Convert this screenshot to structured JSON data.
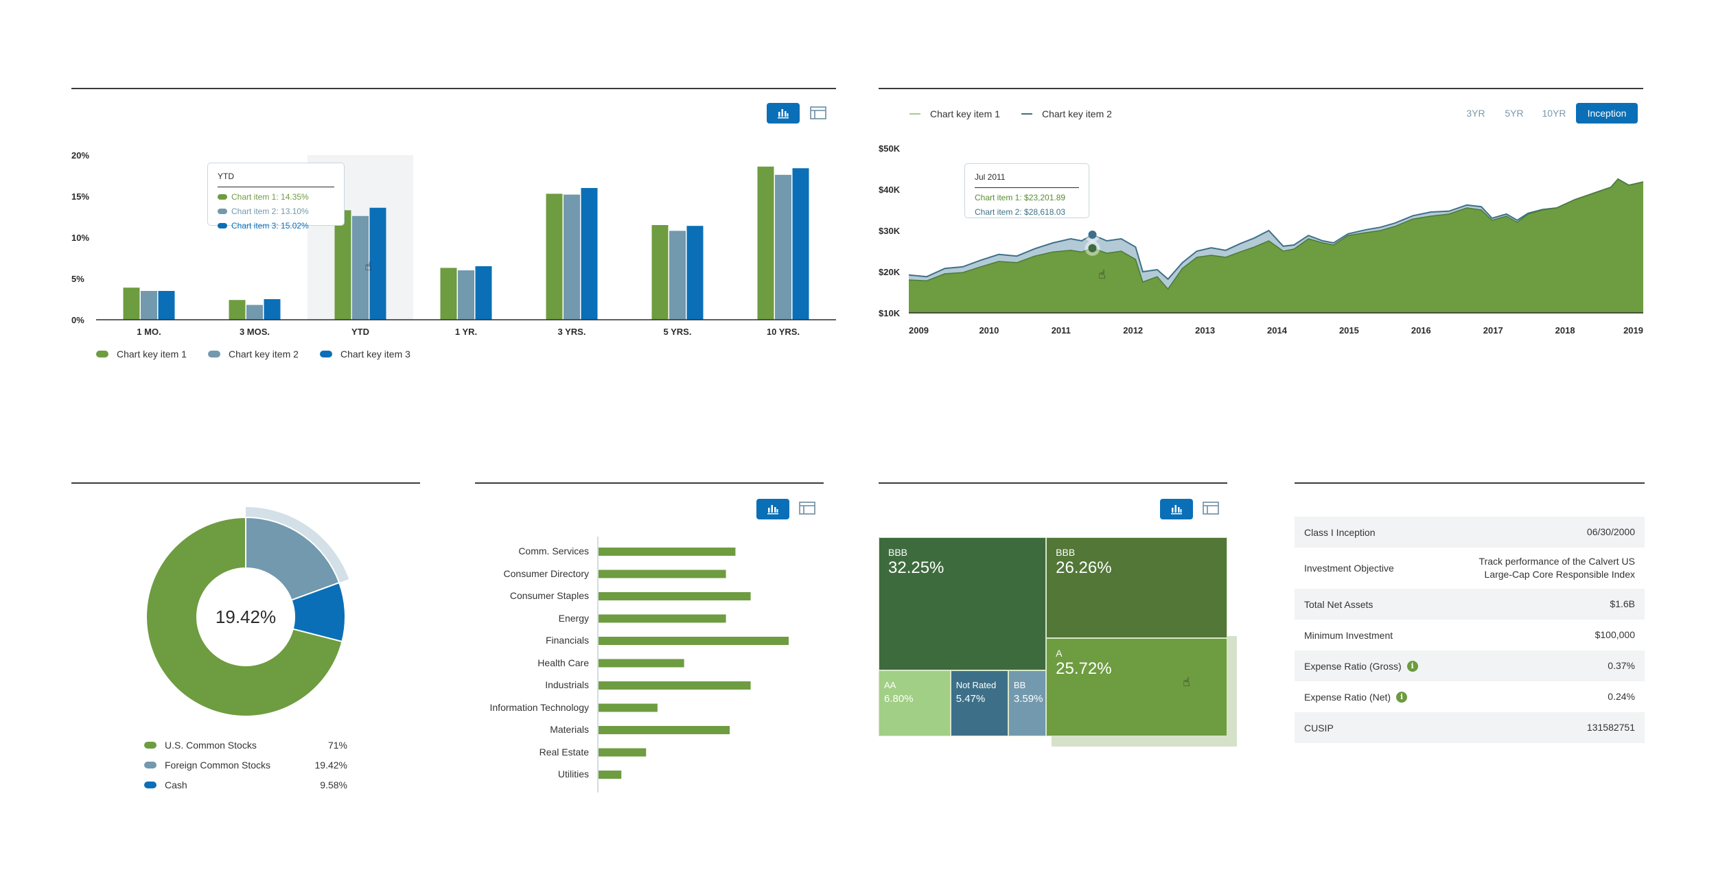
{
  "colors": {
    "green": "#6e9c40",
    "slate": "#7299ad",
    "blue": "#0a6fb7",
    "dark_slate": "#3d7088",
    "hover_bg": "#f1f3f4",
    "highlight_ring": "#d4e0e7"
  },
  "view_toggle": {
    "chart_icon": "bar-chart-icon",
    "table_icon": "table-icon"
  },
  "chart_data": [
    {
      "id": "performance-bars",
      "type": "bar",
      "title": "",
      "xlabel": "",
      "ylabel": "",
      "categories": [
        "1 MO.",
        "3 MOS.",
        "YTD",
        "1 YR.",
        "3 YRS.",
        "5 YRS.",
        "10 YRS."
      ],
      "series": [
        {
          "name": "Chart key item 1",
          "color": "#6e9c40",
          "values": [
            3.9,
            2.4,
            13.3,
            6.3,
            15.3,
            11.5,
            18.6
          ]
        },
        {
          "name": "Chart key item 2",
          "color": "#7299ad",
          "values": [
            3.5,
            1.8,
            12.6,
            6.0,
            15.2,
            10.8,
            17.6
          ]
        },
        {
          "name": "Chart key item 3",
          "color": "#0a6fb7",
          "values": [
            3.5,
            2.5,
            13.6,
            6.5,
            16.0,
            11.4,
            18.4
          ]
        }
      ],
      "yticks": [
        "0%",
        "5%",
        "10%",
        "15%",
        "20%"
      ],
      "ylim": [
        0,
        20
      ],
      "grid": false,
      "legend_position": "bottom-left",
      "highlighted_category": "YTD",
      "tooltip": {
        "title": "YTD",
        "rows": [
          {
            "label": "Chart item 1: 14.35%",
            "color": "#6e9c40"
          },
          {
            "label": "Chart item 2: 13.10%",
            "color": "#7299ad"
          },
          {
            "label": "Chart item 3: 15.02%",
            "color": "#0a6fb7"
          }
        ]
      }
    },
    {
      "id": "growth-area",
      "type": "area",
      "title": "",
      "xlabel": "",
      "ylabel": "",
      "ylim": [
        10000,
        50000
      ],
      "yticks": [
        "$10K",
        "$20K",
        "$30K",
        "$40K",
        "$50K"
      ],
      "xticks": [
        "2009",
        "2010",
        "2011",
        "2012",
        "2013",
        "2014",
        "2015",
        "2016",
        "2017",
        "2018",
        "2019"
      ],
      "xlim": [
        2009.0,
        2019.2
      ],
      "grid": false,
      "legend_position": "top-left",
      "x": [
        2009.0,
        2009.25,
        2009.5,
        2009.75,
        2010.0,
        2010.25,
        2010.5,
        2010.75,
        2011.0,
        2011.25,
        2011.4,
        2011.55,
        2011.75,
        2011.95,
        2012.15,
        2012.25,
        2012.45,
        2012.6,
        2012.8,
        2013.0,
        2013.2,
        2013.4,
        2013.6,
        2013.8,
        2014.0,
        2014.2,
        2014.35,
        2014.55,
        2014.75,
        2014.9,
        2015.1,
        2015.35,
        2015.55,
        2015.75,
        2016.0,
        2016.25,
        2016.5,
        2016.75,
        2016.95,
        2017.1,
        2017.3,
        2017.45,
        2017.6,
        2017.8,
        2018.0,
        2018.25,
        2018.5,
        2018.75,
        2018.85,
        2019.0,
        2019.2
      ],
      "series": [
        {
          "name": "Chart key item 1",
          "color": "#6e9c40",
          "values": [
            18000,
            17800,
            19500,
            19800,
            21200,
            22500,
            22200,
            23800,
            24800,
            25200,
            24800,
            25700,
            24500,
            25000,
            23000,
            17500,
            18800,
            15800,
            20800,
            23500,
            24000,
            23500,
            24800,
            26000,
            27500,
            25000,
            25500,
            28000,
            27000,
            26500,
            28800,
            29500,
            30000,
            31000,
            32800,
            33500,
            34000,
            35500,
            35000,
            32500,
            33500,
            32000,
            34000,
            35000,
            35500,
            37500,
            39000,
            40500,
            42500,
            41000,
            41800
          ]
        },
        {
          "name": "Chart key item 2",
          "color": "#3d7088",
          "values": [
            19200,
            18800,
            20800,
            21200,
            22800,
            24200,
            23800,
            25600,
            27000,
            28000,
            27500,
            29000,
            27500,
            28000,
            26000,
            20000,
            20500,
            18200,
            22200,
            25000,
            25800,
            25200,
            26800,
            28200,
            30000,
            26200,
            26500,
            28800,
            27500,
            27000,
            29200,
            30200,
            30800,
            31800,
            33600,
            34500,
            34700,
            36200,
            35800,
            33000,
            34000,
            32500,
            34200,
            35100,
            35500,
            37500,
            39000,
            40500,
            42500,
            41000,
            41800
          ]
        }
      ],
      "tooltip": {
        "title": "Jul 2011",
        "rows": [
          {
            "label": "Chart item 1: $23,201.89",
            "color": "#5a8a34"
          },
          {
            "label": "Chart item 2: $28,618.03",
            "color": "#3d7088"
          }
        ]
      },
      "hover_x": 2011.55,
      "range_tabs": [
        {
          "label": "3YR",
          "active": false
        },
        {
          "label": "5YR",
          "active": false
        },
        {
          "label": "10YR",
          "active": false
        },
        {
          "label": "Inception",
          "active": true
        }
      ]
    },
    {
      "id": "allocation-donut",
      "type": "pie",
      "title": "",
      "center_label": "19.42%",
      "highlighted_slice": "Foreign Common Stocks",
      "slices": [
        {
          "label": "Foreign Common Stocks",
          "value": 19.42,
          "display": "19.42%",
          "color": "#7299ad"
        },
        {
          "label": "Cash",
          "value": 9.58,
          "display": "9.58%",
          "color": "#0a6fb7"
        },
        {
          "label": "U.S. Common Stocks",
          "value": 71,
          "display": "71%",
          "color": "#6e9c40"
        }
      ],
      "legend_order": [
        "U.S. Common Stocks",
        "Foreign Common Stocks",
        "Cash"
      ],
      "legend_position": "bottom"
    },
    {
      "id": "sector-bars",
      "type": "bar",
      "orientation": "horizontal",
      "title": "",
      "xlabel": "",
      "ylabel": "",
      "categories": [
        "Comm. Services",
        "Consumer Directory",
        "Consumer Staples",
        "Energy",
        "Financials",
        "Health Care",
        "Industrials",
        "Information Technology",
        "Materials",
        "Real Estate",
        "Utilities"
      ],
      "values": [
        0.72,
        0.67,
        0.8,
        0.67,
        1.0,
        0.45,
        0.8,
        0.31,
        0.69,
        0.25,
        0.12
      ],
      "value_units": "relative to largest (no axis scale shown)",
      "color": "#6e9c40",
      "grid": false
    },
    {
      "id": "credit-treemap",
      "type": "heatmap",
      "subtype": "treemap",
      "title": "",
      "highlighted_cell": "A",
      "cells": [
        {
          "name": "BBB",
          "value": 32.25,
          "display": "32.25%",
          "color": "#3e6b3d"
        },
        {
          "name": "BBB",
          "value": 26.26,
          "display": "26.26%",
          "color": "#527737"
        },
        {
          "name": "A",
          "value": 25.72,
          "display": "25.72%",
          "color": "#6e9c40"
        },
        {
          "name": "AA",
          "value": 6.8,
          "display": "6.80%",
          "color": "#a1cf85"
        },
        {
          "name": "Not Rated",
          "value": 5.47,
          "display": "5.47%",
          "color": "#3d7088"
        },
        {
          "name": "BB",
          "value": 3.59,
          "display": "3.59%",
          "color": "#7299ad"
        }
      ]
    }
  ],
  "fund_facts": {
    "rows": [
      {
        "label": "Class I Inception",
        "value": "06/30/2000",
        "info": false
      },
      {
        "label": "Investment Objective",
        "value": "Track performance of the Calvert US Large-Cap Core Responsible Index",
        "value_lines": [
          "Track performance of the Calvert US",
          "Large-Cap Core Responsible Index"
        ],
        "info": false
      },
      {
        "label": "Total Net Assets",
        "value": "$1.6B",
        "info": false
      },
      {
        "label": "Minimum Investment",
        "value": "$100,000",
        "info": false
      },
      {
        "label": "Expense Ratio (Gross)",
        "value": "0.37%",
        "info": true
      },
      {
        "label": "Expense Ratio (Net)",
        "value": "0.24%",
        "info": true
      },
      {
        "label": "CUSIP",
        "value": "131582751",
        "info": false
      }
    ],
    "info_icon_glyph": "i"
  },
  "cursor_glyph": "☝"
}
